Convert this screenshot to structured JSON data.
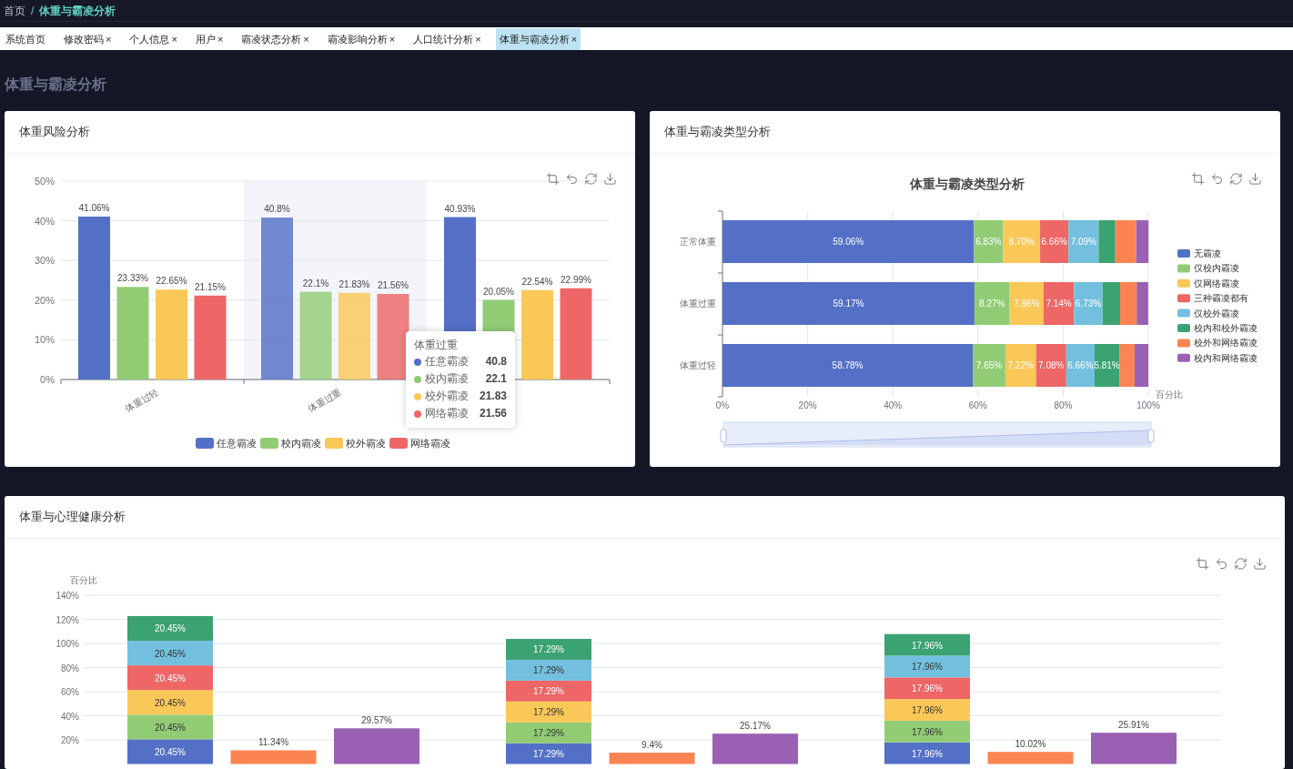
{
  "breadcrumb": {
    "home": "首页",
    "separator": "/",
    "current": "体重与霸凌分析"
  },
  "tabs": [
    {
      "label": "系统首页",
      "selected": false
    },
    {
      "label": "修改密码",
      "close": "×",
      "selected": false
    },
    {
      "label": "个人信息",
      "close": "×",
      "selected": false
    },
    {
      "label": "用户",
      "close": "×",
      "selected": false
    },
    {
      "label": "霸凌状态分析",
      "close": "×",
      "selected": false
    },
    {
      "label": "霸凌影响分析",
      "close": "×",
      "selected": false
    },
    {
      "label": "人口统计分析",
      "close": "×",
      "selected": false
    },
    {
      "label": "体重与霸凌分析",
      "close": "×",
      "selected": true
    }
  ],
  "page_title": "体重与霸凌分析",
  "weight_risk": {
    "title": "体重风险分析",
    "chart_data": {
      "type": "bar",
      "ylim": [
        0,
        50
      ],
      "yticks": [
        {
          "value": 0,
          "label": "0%"
        },
        {
          "value": 10,
          "label": "10%"
        },
        {
          "value": 20,
          "label": "20%"
        },
        {
          "value": 30,
          "label": "30%"
        },
        {
          "value": 40,
          "label": "40%"
        },
        {
          "value": 50,
          "label": "50%"
        }
      ],
      "categories": [
        "体重过轻",
        "体重过重",
        null
      ],
      "grid": true,
      "legend": true,
      "bands": [
        {
          "axis": "x",
          "from": "体重过重",
          "to": "体重过重"
        }
      ],
      "series": [
        {
          "name": "任意霸凌",
          "color": "#5470c6",
          "values": [
            41.06,
            40.8,
            40.93
          ],
          "value_labels": [
            "41.06%",
            "40.8%",
            "40.93%"
          ]
        },
        {
          "name": "校内霸凌",
          "color": "#91cc75",
          "values": [
            23.33,
            22.1,
            20.05
          ],
          "value_labels": [
            "23.33%",
            "22.1%",
            "20.05%"
          ]
        },
        {
          "name": "校外霸凌",
          "color": "#fac858",
          "values": [
            22.65,
            21.83,
            22.54
          ],
          "value_labels": [
            "22.65%",
            "21.83%",
            "22.54%"
          ]
        },
        {
          "name": "网络霸凌",
          "color": "#ee6666",
          "values": [
            21.15,
            21.56,
            22.99
          ],
          "value_labels": [
            "21.15%",
            "21.56%",
            "22.99%"
          ]
        }
      ]
    },
    "tooltip": {
      "title": "体重过重",
      "rows": [
        {
          "name": "任意霸凌",
          "color": "#5470c6",
          "value": "40.8"
        },
        {
          "name": "校内霸凌",
          "color": "#91cc75",
          "value": "22.1"
        },
        {
          "name": "校外霸凌",
          "color": "#fac858",
          "value": "21.83"
        },
        {
          "name": "网络霸凌",
          "color": "#ee6666",
          "value": "21.56"
        }
      ]
    }
  },
  "bullying_type": {
    "title": "体重与霸凌类型分析",
    "chart_data": {
      "type": "bar",
      "orientation": "horizontal",
      "stacked": true,
      "title": "体重与霸凌类型分析",
      "xlabel": "百分比",
      "grid": true,
      "legend": true,
      "xlim": [
        0,
        100
      ],
      "xticks": [
        {
          "value": 0,
          "label": "0%"
        },
        {
          "value": 20,
          "label": "20%"
        },
        {
          "value": 40,
          "label": "40%"
        },
        {
          "value": 60,
          "label": "60%"
        },
        {
          "value": 80,
          "label": "80%"
        },
        {
          "value": 100,
          "label": "100%"
        }
      ],
      "categories": [
        "正常体重",
        "体重过重",
        "体重过轻"
      ],
      "series": [
        {
          "name": "无霸凌",
          "color": "#5470c6",
          "values": [
            59.06,
            59.17,
            58.78
          ],
          "value_labels": [
            "59.06%",
            "59.17%",
            "58.78%"
          ]
        },
        {
          "name": "仅校内霸凌",
          "color": "#91cc75",
          "values": [
            6.83,
            8.27,
            7.65
          ],
          "value_labels": [
            "6.83%",
            "8.27%",
            "7.65%"
          ]
        },
        {
          "name": "仅网络霸凌",
          "color": "#fac858",
          "values": [
            8.7,
            7.96,
            7.22
          ],
          "value_labels": [
            "8.70%",
            "7.96%",
            "7.22%"
          ]
        },
        {
          "name": "三种霸凌都有",
          "color": "#ee6666",
          "values": [
            6.66,
            7.14,
            7.08
          ],
          "value_labels": [
            "6.66%",
            "7.14%",
            "7.08%"
          ]
        },
        {
          "name": "仅校外霸凌",
          "color": "#73c0de",
          "values": [
            7.09,
            6.73,
            6.66
          ],
          "value_labels": [
            "7.09%",
            "6.73%",
            "6.66%"
          ]
        },
        {
          "name": "校内和校外霸凌",
          "color": "#3ba272",
          "values": [
            3.9,
            4.1,
            5.81
          ],
          "value_labels": [
            null,
            null,
            "5.81%"
          ]
        },
        {
          "name": "校外和网络霸凌",
          "color": "#fc8452",
          "values": [
            4.9,
            3.9,
            3.6
          ]
        },
        {
          "name": "校内和网络霸凌",
          "color": "#9a60b4",
          "values": [
            2.9,
            2.7,
            3.2
          ]
        }
      ]
    }
  },
  "mental_health": {
    "title": "体重与心理健康分析",
    "chart_data": {
      "type": "bar",
      "stacked": true,
      "ylabel": "百分比",
      "ylim": [
        0,
        140
      ],
      "grid": true,
      "yticks": [
        {
          "value": 20,
          "label": "20%"
        },
        {
          "value": 40,
          "label": "40%"
        },
        {
          "value": 60,
          "label": "60%"
        },
        {
          "value": 80,
          "label": "80%"
        },
        {
          "value": 100,
          "label": "100%"
        },
        {
          "value": 120,
          "label": "120%"
        },
        {
          "value": 140,
          "label": "140%"
        }
      ],
      "series": [
        {
          "color": "#5470c6",
          "values": [
            20.45,
            null,
            null,
            17.29,
            null,
            null,
            17.96,
            null,
            null
          ],
          "value_labels": [
            "20.45%",
            null,
            null,
            "17.29%",
            null,
            null,
            "17.96%",
            null,
            null
          ]
        },
        {
          "color": "#91cc75",
          "values": [
            20.45,
            null,
            null,
            17.29,
            null,
            null,
            17.96,
            null,
            null
          ],
          "value_labels": [
            "20.45%",
            null,
            null,
            "17.29%",
            null,
            null,
            "17.96%",
            null,
            null
          ]
        },
        {
          "color": "#fac858",
          "values": [
            20.45,
            null,
            null,
            17.29,
            null,
            null,
            17.96,
            null,
            null
          ],
          "value_labels": [
            "20.45%",
            null,
            null,
            "17.29%",
            null,
            null,
            "17.96%",
            null,
            null
          ]
        },
        {
          "color": "#ee6666",
          "values": [
            20.45,
            null,
            null,
            17.29,
            null,
            null,
            17.96,
            null,
            null
          ],
          "value_labels": [
            "20.45%",
            null,
            null,
            "17.29%",
            null,
            null,
            "17.96%",
            null,
            null
          ]
        },
        {
          "color": "#73c0de",
          "values": [
            20.45,
            null,
            null,
            17.29,
            null,
            null,
            17.96,
            null,
            null
          ],
          "value_labels": [
            "20.45%",
            null,
            null,
            "17.29%",
            null,
            null,
            "17.96%",
            null,
            null
          ]
        },
        {
          "color": "#3ba272",
          "values": [
            20.45,
            null,
            null,
            17.29,
            null,
            null,
            17.96,
            null,
            null
          ],
          "value_labels": [
            "20.45%",
            null,
            null,
            "17.29%",
            null,
            null,
            "17.96%",
            null,
            null
          ]
        },
        {
          "color": "#fc8452",
          "values": [
            null,
            11.34,
            null,
            null,
            9.4,
            null,
            null,
            10.02,
            null
          ],
          "value_labels": [
            null,
            "11.34%",
            null,
            null,
            "9.4%",
            null,
            null,
            "10.02%",
            null
          ]
        },
        {
          "color": "#9a60b4",
          "values": [
            null,
            null,
            29.57,
            null,
            null,
            25.17,
            null,
            null,
            25.91
          ],
          "value_labels": [
            null,
            null,
            "29.57%",
            null,
            null,
            "25.17%",
            null,
            null,
            "25.91%"
          ]
        }
      ]
    }
  }
}
